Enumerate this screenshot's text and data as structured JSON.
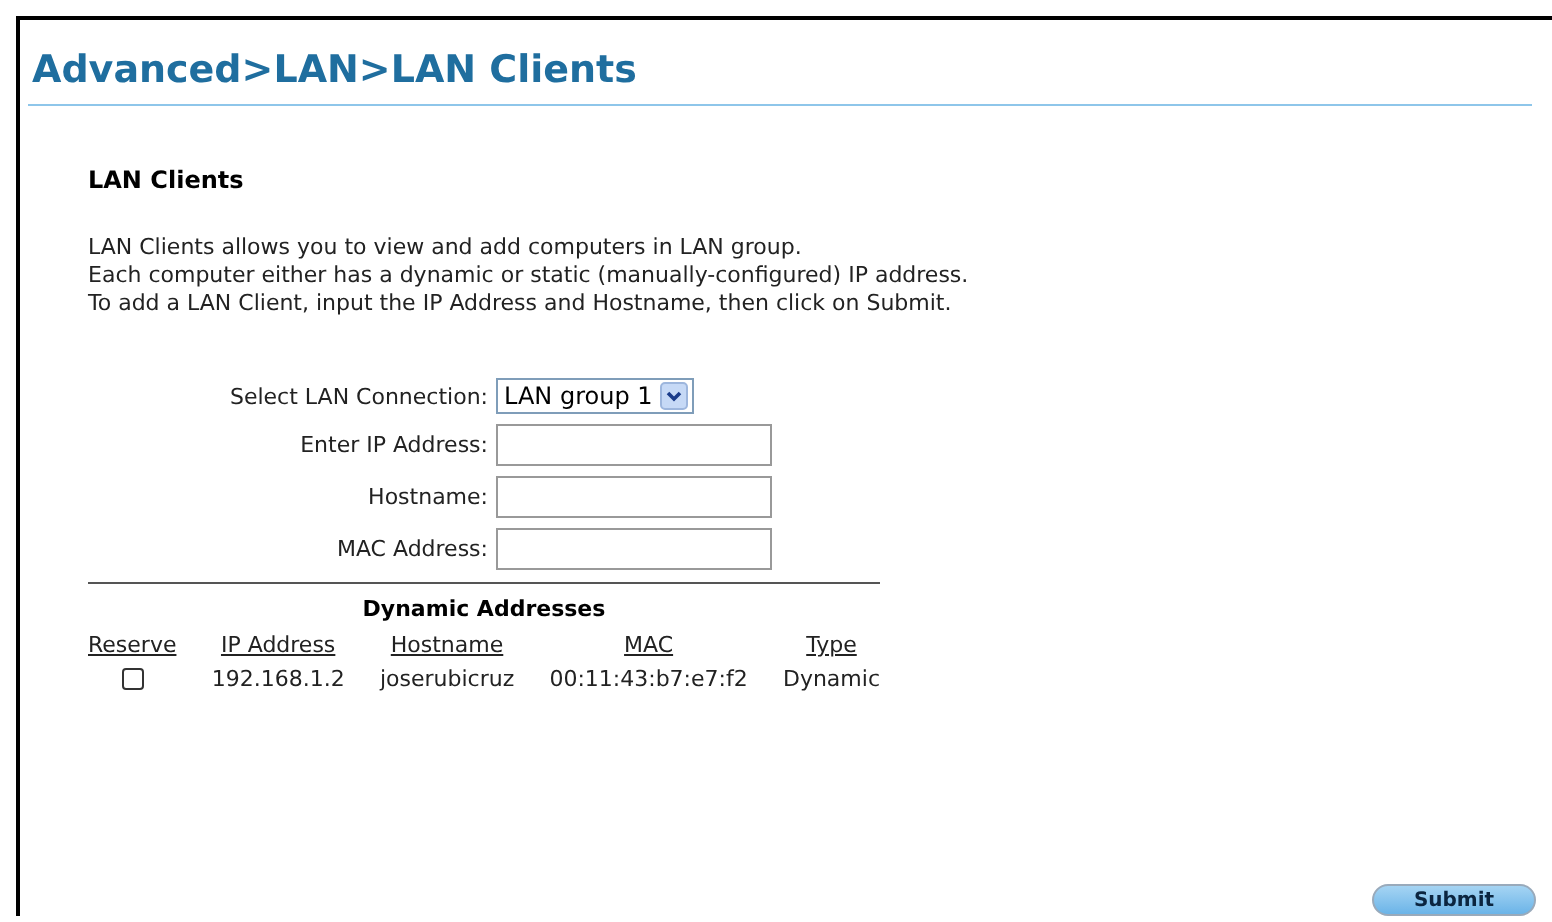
{
  "breadcrumb": "Advanced>LAN>LAN Clients",
  "section_title": "LAN Clients",
  "description": [
    "LAN Clients allows you to view and add computers in LAN group.",
    "Each computer either has a dynamic or static (manually-configured) IP address.",
    "To add a LAN Client, input the IP Address and Hostname, then click on Submit."
  ],
  "form": [
    {
      "kind": "select",
      "label": "Select LAN Connection:",
      "value": "LAN group 1"
    },
    {
      "kind": "text",
      "label": "Enter IP Address:"
    },
    {
      "kind": "text",
      "label": "Hostname:"
    },
    {
      "kind": "text",
      "label": "MAC Address:"
    }
  ],
  "table": {
    "title": "Dynamic Addresses",
    "columns": [
      "Reserve",
      "IP Address",
      "Hostname",
      "MAC",
      "Type"
    ],
    "rows": [
      {
        "reserve": false,
        "cells": [
          "",
          "192.168.1.2",
          "joserubicruz",
          "00:11:43:b7:e7:f2",
          "Dynamic"
        ]
      }
    ]
  },
  "submit_button": "Submit"
}
